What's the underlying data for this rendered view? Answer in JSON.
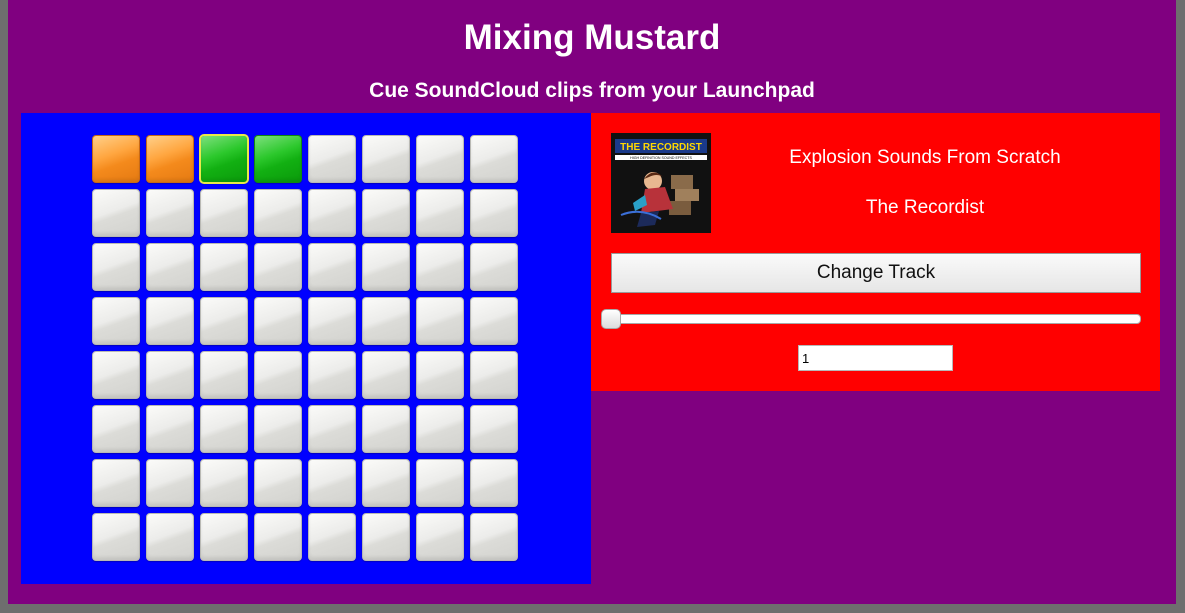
{
  "app": {
    "title": "Mixing Mustard",
    "subtitle": "Cue SoundCloud clips from your Launchpad"
  },
  "colors": {
    "background": "#800080",
    "pad_panel": "#0000ff",
    "track_panel": "#ff0000",
    "pad_orange": "#ffa640",
    "pad_green": "#12b012",
    "pad_idle": "#e4e4e0",
    "selected_outline": "#e8e84a"
  },
  "launchpad": {
    "rows": 8,
    "columns": 8,
    "active_pads": [
      {
        "row": 0,
        "col": 0,
        "color": "orange"
      },
      {
        "row": 0,
        "col": 1,
        "color": "orange"
      },
      {
        "row": 0,
        "col": 2,
        "color": "green",
        "selected": true
      },
      {
        "row": 0,
        "col": 3,
        "color": "green"
      }
    ]
  },
  "track": {
    "cover_icon": "album-cover-image",
    "cover_text": "THE RECORDIST",
    "cover_subtext": "HIGH DEFINITION SOUND EFFECTS",
    "title": "Explosion Sounds From Scratch",
    "artist": "The Recordist",
    "change_button_label": "Change Track",
    "slider_position": 0,
    "number_value": "1"
  }
}
